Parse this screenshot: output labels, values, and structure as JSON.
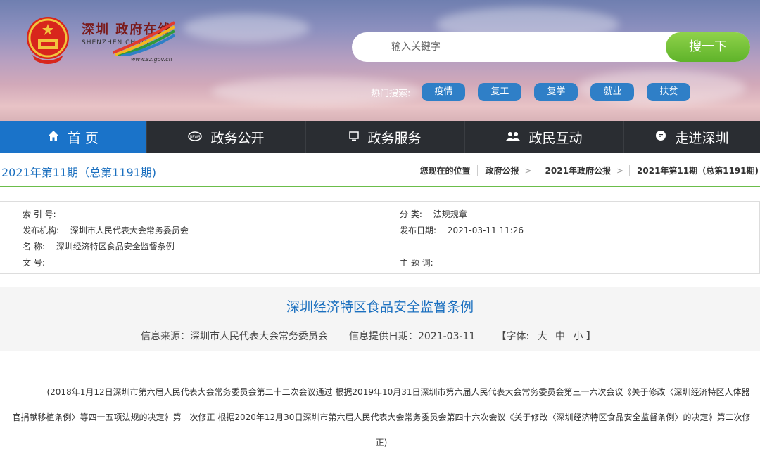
{
  "header": {
    "logo_cn": "深圳 政府在线",
    "logo_en": "SHENZHEN CHINA",
    "logo_url": "www.sz.gov.cn",
    "search_placeholder": "输入关键字",
    "search_button": "搜一下",
    "hot_label": "热门搜索:",
    "hot_tags": [
      "疫情",
      "复工",
      "复学",
      "就业",
      "扶贫"
    ]
  },
  "nav": {
    "items": [
      {
        "label": "首 页",
        "icon": "home-icon"
      },
      {
        "label": "政务公开",
        "icon": "news-icon"
      },
      {
        "label": "政务服务",
        "icon": "monitor-icon"
      },
      {
        "label": "政民互动",
        "icon": "people-icon"
      },
      {
        "label": "走进深圳",
        "icon": "chat-icon"
      }
    ]
  },
  "breadcrumb": {
    "issue": "2021年第11期（总第1191期)",
    "location_label": "您现在的位置",
    "items": [
      "政府公报",
      "2021年政府公报",
      "2021年第11期（总第1191期)"
    ]
  },
  "meta": {
    "index_key": "索 引 号:",
    "index_val": "",
    "org_key": "发布机构:",
    "org_val": "深圳市人民代表大会常务委员会",
    "name_key": "名 称:",
    "name_val": "深圳经济特区食品安全监督条例",
    "doc_key": "文 号:",
    "doc_val": "",
    "category_key": "分 类:",
    "category_val": "法规规章",
    "date_key": "发布日期:",
    "date_val": "2021-03-11 11:26",
    "topic_key": "主 题 词:",
    "topic_val": ""
  },
  "document": {
    "title": "深圳经济特区食品安全监督条例",
    "source": "信息来源：深圳市人民代表大会常务委员会",
    "provided_date": "信息提供日期：2021-03-11",
    "font_label_open": "【字体:",
    "font_large": "大",
    "font_medium": "中",
    "font_small": "小",
    "font_label_close": "】",
    "paragraph": "(2018年1月12日深圳市第六届人民代表大会常务委员会第二十二次会议通过 根据2019年10月31日深圳市第六届人民代表大会常务委员会第三十六次会议《关于修改〈深圳经济特区人体器官捐献移植条例〉等四十五项法规的决定》第一次修正 根据2020年12月30日深圳市第六届人民代表大会常务委员会第四十六次会议《关于修改〈深圳经济特区食品安全监督条例〉的决定》第二次修正)"
  }
}
